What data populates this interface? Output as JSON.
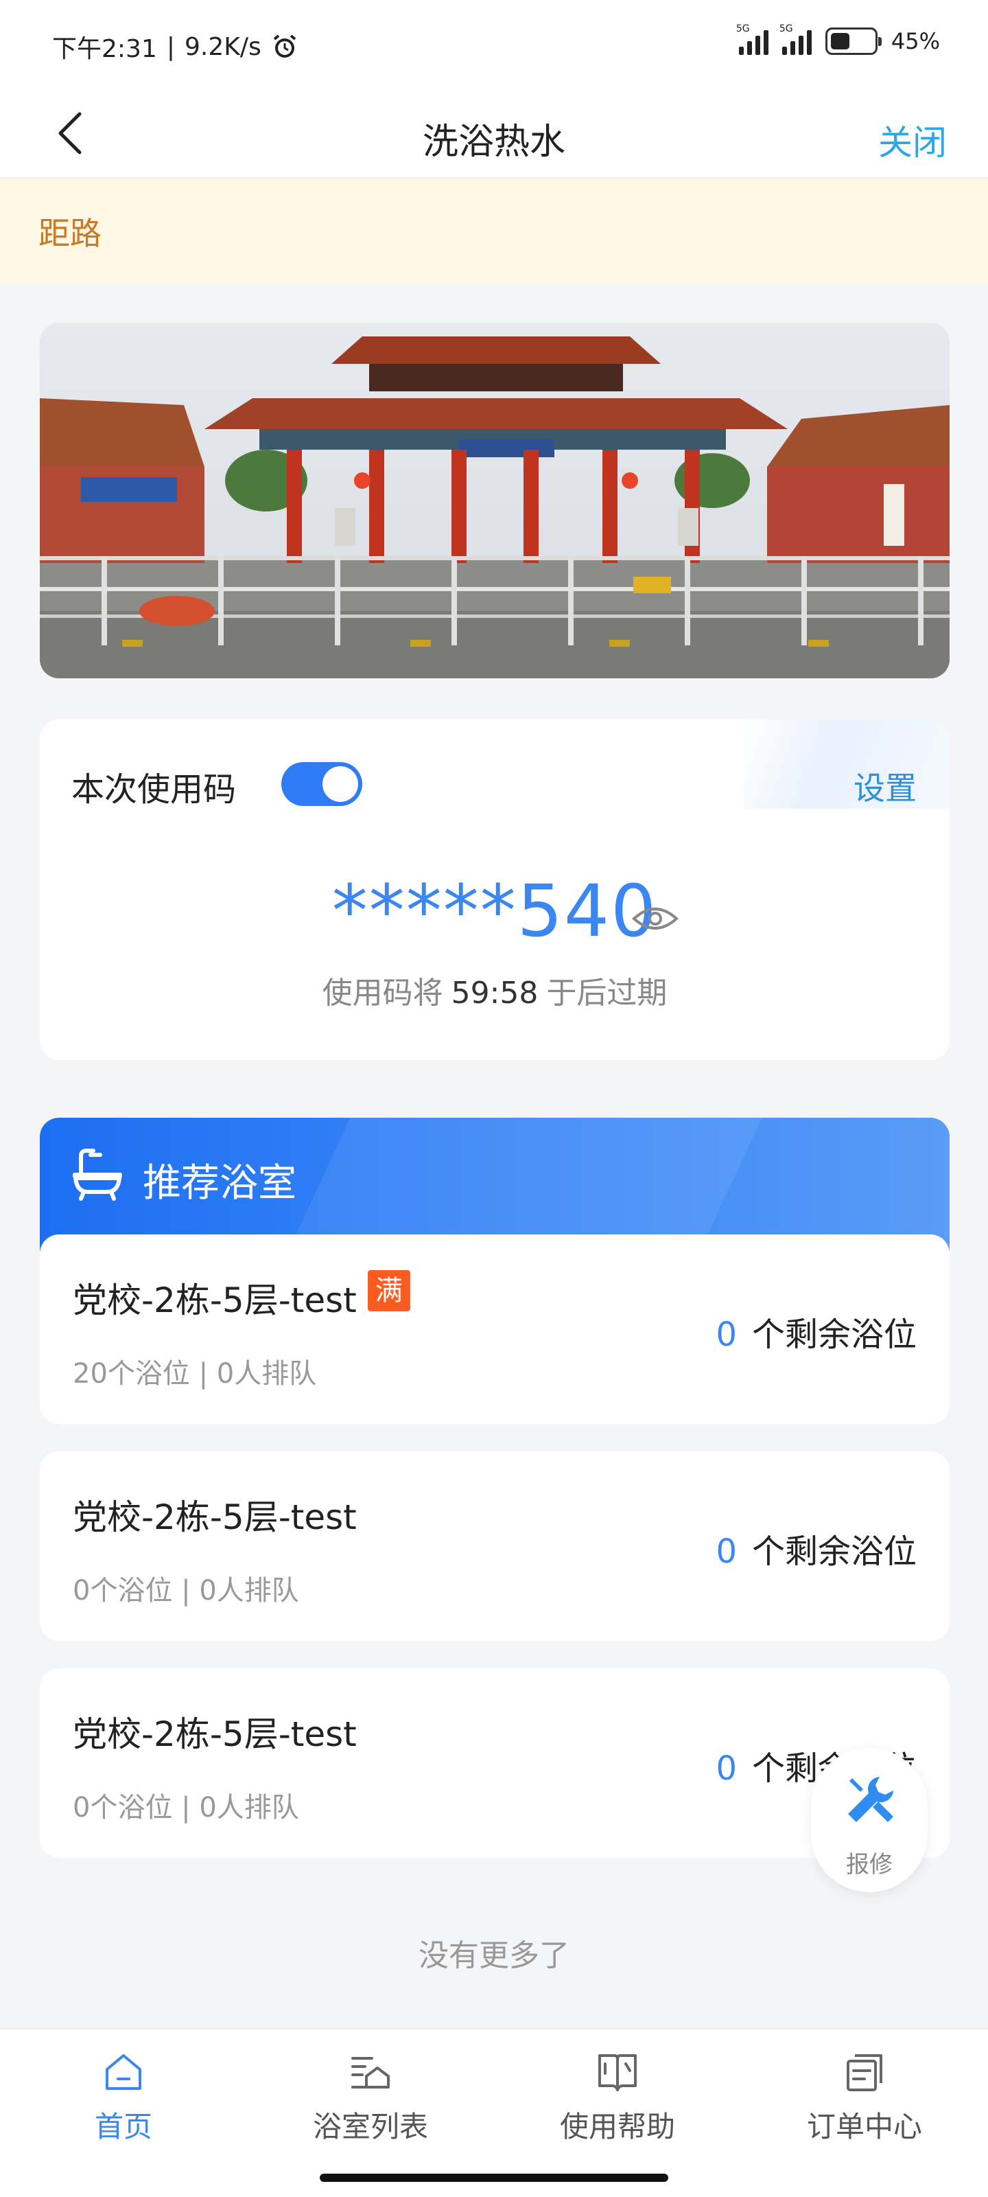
{
  "status_bar": {
    "time": "下午2:31",
    "speed": "9.2K/s",
    "network_1": "5G",
    "network_2": "5G",
    "battery": "45%",
    "battery_level": 0.45
  },
  "nav": {
    "title": "洗浴热水",
    "close_label": "关闭"
  },
  "notice": {
    "text": "距路"
  },
  "use_code": {
    "label": "本次使用码",
    "toggle_on": true,
    "settings_label": "设置",
    "code": "*****540",
    "expire_prefix": "使用码将",
    "expire_time": "59:58",
    "expire_suffix": "于后过期"
  },
  "recommended": {
    "title": "推荐浴室",
    "rooms": [
      {
        "name": "党校-2栋-5层-test",
        "badge": "满",
        "sub": "20个浴位 | 0人排队",
        "remain": "0",
        "remain_label": "个剩余浴位"
      },
      {
        "name": "党校-2栋-5层-test",
        "badge": "",
        "sub": "0个浴位 | 0人排队",
        "remain": "0",
        "remain_label": "个剩余浴位"
      },
      {
        "name": "党校-2栋-5层-test",
        "badge": "",
        "sub": "0个浴位 | 0人排队",
        "remain": "0",
        "remain_label": "个剩余浴位"
      }
    ],
    "no_more": "没有更多了"
  },
  "repair": {
    "label": "报修"
  },
  "tabs": [
    {
      "label": "首页",
      "icon": "home-icon",
      "active": true
    },
    {
      "label": "浴室列表",
      "icon": "list-icon",
      "active": false
    },
    {
      "label": "使用帮助",
      "icon": "book-icon",
      "active": false
    },
    {
      "label": "订单中心",
      "icon": "order-icon",
      "active": false
    }
  ],
  "colors": {
    "accent": "#3a86f2",
    "header_blue": "#1d6ff2",
    "badge_orange": "#ff5a1f",
    "notice_bg": "#fff8e4",
    "close_cyan": "#2ba7e8"
  }
}
